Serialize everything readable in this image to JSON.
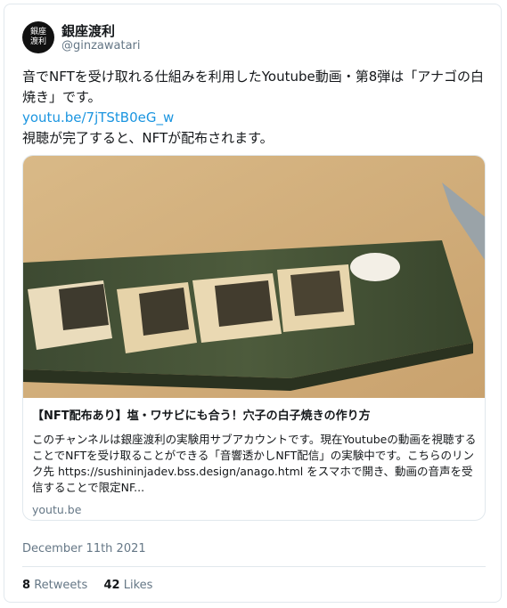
{
  "account": {
    "avatar_text": "銀座渡利",
    "name": "銀座渡利",
    "handle": "@ginzawatari"
  },
  "tweet": {
    "line1": "音でNFTを受け取れる仕組みを利用したYoutube動画・第8弾は「アナゴの白焼き」です。",
    "link": "youtu.be/7jTStB0eG_w",
    "line2": "視聴が完了すると、NFTが配布されます。"
  },
  "preview": {
    "title": "【NFT配布あり】塩・ワサビにも合う！穴子の白子焼きの作り方",
    "description": "このチャンネルは銀座渡利の実験用サブアカウントです。現在Youtubeの動画を視聴することでNFTを受け取ることができる「音響透かしNFT配信」の実験中です。こちらのリンク先 https://sushininjadev.bss.design/anago.html をスマホで開き、動画の音声を受信することで限定NF...",
    "domain": "youtu.be"
  },
  "date": "December 11th 2021",
  "stats": {
    "retweets_count": "8",
    "retweets_label": "Retweets",
    "likes_count": "42",
    "likes_label": "Likes"
  },
  "colors": {
    "link": "#1b95e0",
    "muted": "#657786",
    "border": "#e1e8ed"
  }
}
